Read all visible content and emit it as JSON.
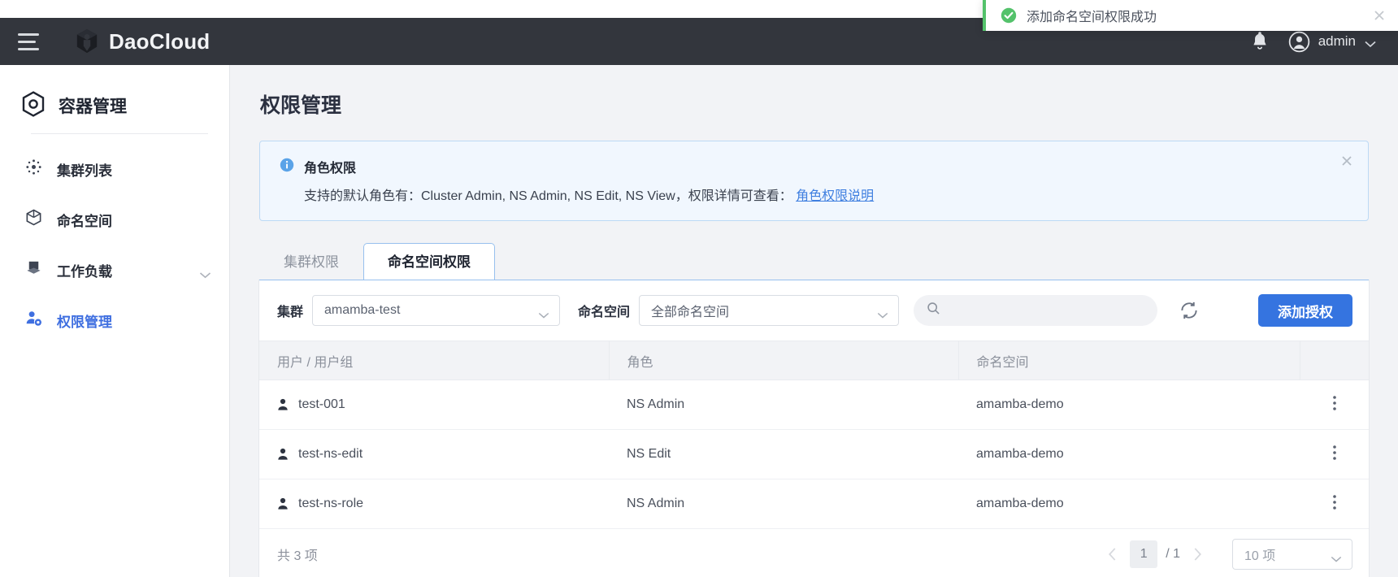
{
  "toast": {
    "icon": "success-check-icon",
    "message": "添加命名空间权限成功",
    "close_label": "×",
    "accent_color": "#54c26b"
  },
  "header": {
    "menu_icon": "hamburger-icon",
    "brand": "DaoCloud",
    "brand_icon": "daocloud-cube-logo",
    "bell_icon": "bell-icon",
    "avatar_icon": "user-avatar-icon",
    "user_name": "admin",
    "caret_icon": "chevron-down-icon",
    "bg_color": "#33363d"
  },
  "sidebar": {
    "title": "容器管理",
    "title_icon": "cube-hex-icon",
    "items": [
      {
        "label": "集群列表",
        "icon": "cluster-nodes-icon",
        "active": false,
        "expandable": false
      },
      {
        "label": "命名空间",
        "icon": "namespace-cube-icon",
        "active": false,
        "expandable": false
      },
      {
        "label": "工作负载",
        "icon": "workload-stack-icon",
        "active": false,
        "expandable": true
      },
      {
        "label": "权限管理",
        "icon": "user-gear-icon",
        "active": true,
        "expandable": false
      }
    ],
    "active_color": "#3f6fe0"
  },
  "main": {
    "page_title": "权限管理",
    "banner": {
      "icon": "info-circle-icon",
      "title": "角色权限",
      "body_prefix": "支持的默认角色有：Cluster Admin, NS Admin, NS Edit, NS View，权限详情可查看：",
      "link_text": "角色权限说明",
      "close_label": "×"
    },
    "tabs": [
      {
        "label": "集群权限",
        "active": false
      },
      {
        "label": "命名空间权限",
        "active": true
      }
    ],
    "filters": {
      "cluster_label": "集群",
      "cluster_value": "amamba-test",
      "namespace_label": "命名空间",
      "namespace_value": "全部命名空间",
      "search_icon": "search-icon",
      "search_value": "",
      "search_placeholder": "",
      "refresh_icon": "refresh-icon",
      "add_button": "添加授权",
      "add_button_color": "#3574e0"
    },
    "table": {
      "columns": [
        "用户 / 用户组",
        "角色",
        "命名空间",
        ""
      ],
      "rows": [
        {
          "user": "test-001",
          "role": "NS Admin",
          "namespace": "amamba-demo",
          "user_icon": "person-icon",
          "action_icon": "kebab-menu-icon"
        },
        {
          "user": "test-ns-edit",
          "role": "NS Edit",
          "namespace": "amamba-demo",
          "user_icon": "person-icon",
          "action_icon": "kebab-menu-icon"
        },
        {
          "user": "test-ns-role",
          "role": "NS Admin",
          "namespace": "amamba-demo",
          "user_icon": "person-icon",
          "action_icon": "kebab-menu-icon"
        }
      ]
    },
    "footer": {
      "total_text": "共 3 项",
      "prev_icon": "chevron-left-icon",
      "next_icon": "chevron-right-icon",
      "current_page": "1",
      "total_pages": "/ 1",
      "page_size": "10 项"
    }
  }
}
